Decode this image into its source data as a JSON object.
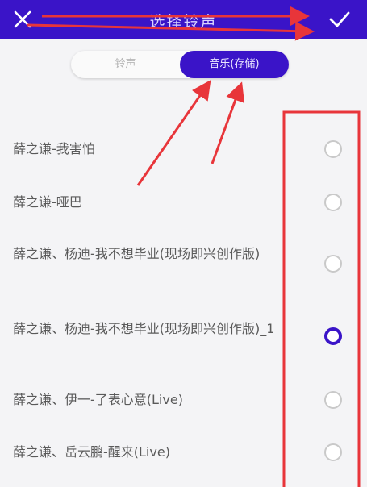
{
  "header": {
    "title": "选择铃声",
    "close_icon": "close-icon",
    "confirm_icon": "check-icon"
  },
  "tabs": [
    {
      "label": "铃声",
      "active": false
    },
    {
      "label": "音乐(存储)",
      "active": true
    }
  ],
  "songs": [
    {
      "title": "薛之谦-我害怕",
      "selected": false
    },
    {
      "title": "薛之谦-哑巴",
      "selected": false
    },
    {
      "title": "薛之谦、杨迪-我不想毕业(现场即兴创作版)",
      "selected": false
    },
    {
      "title": "薛之谦、杨迪-我不想毕业(现场即兴创作版)_1",
      "selected": true
    },
    {
      "title": "薛之谦、伊一-了表心意(Live)",
      "selected": false
    },
    {
      "title": "薛之谦、岳云鹏-醒来(Live)",
      "selected": false
    }
  ],
  "colors": {
    "accent": "#3a14c8",
    "annotation": "#e8353a"
  }
}
